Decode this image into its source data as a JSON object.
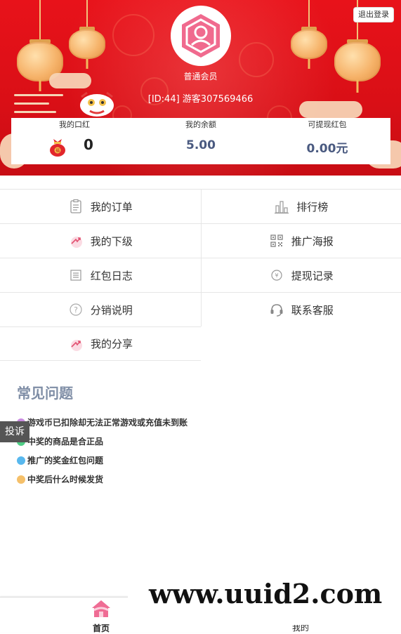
{
  "header": {
    "logout_label": "退出登录",
    "member_level": "普通会员",
    "user_id": "[ID:44] 游客307569466"
  },
  "balance": {
    "lipstick_label": "我的口红",
    "lipstick_value": "0",
    "balance_label": "我的余额",
    "balance_value": "5.00",
    "redpacket_label": "可提现红包",
    "redpacket_value": "0.00元"
  },
  "menu": [
    {
      "label": "我的订单",
      "icon": "clipboard-icon"
    },
    {
      "label": "排行榜",
      "icon": "bar-chart-icon"
    },
    {
      "label": "我的下级",
      "icon": "share-arrow-icon"
    },
    {
      "label": "推广海报",
      "icon": "qr-code-icon"
    },
    {
      "label": "红包日志",
      "icon": "list-icon"
    },
    {
      "label": "提现记录",
      "icon": "coin-icon"
    },
    {
      "label": "分销说明",
      "icon": "question-icon"
    },
    {
      "label": "联系客服",
      "icon": "headset-icon"
    },
    {
      "label": "我的分享",
      "icon": "share-arrow-icon"
    }
  ],
  "faq": {
    "title": "常见问题",
    "items": [
      {
        "text": "游戏币已扣除却无法正常游戏或充值未到账",
        "color": "#c98be0"
      },
      {
        "text": "中奖的商品是合正品",
        "color": "#4fcf86"
      },
      {
        "text": "推广的奖金红包问题",
        "color": "#58b8ee"
      },
      {
        "text": "中奖后什么时候发货",
        "color": "#f5c06a"
      }
    ]
  },
  "complaint_label": "投诉",
  "bottom_nav": {
    "home_label": "首页",
    "mine_label": "我的"
  },
  "watermark": "www.uuid2.com",
  "colors": {
    "header_red": "#d90f16",
    "value_blue": "#4a5a80",
    "faq_title": "#7f8ea6",
    "home_pink": "#ef6c94"
  }
}
